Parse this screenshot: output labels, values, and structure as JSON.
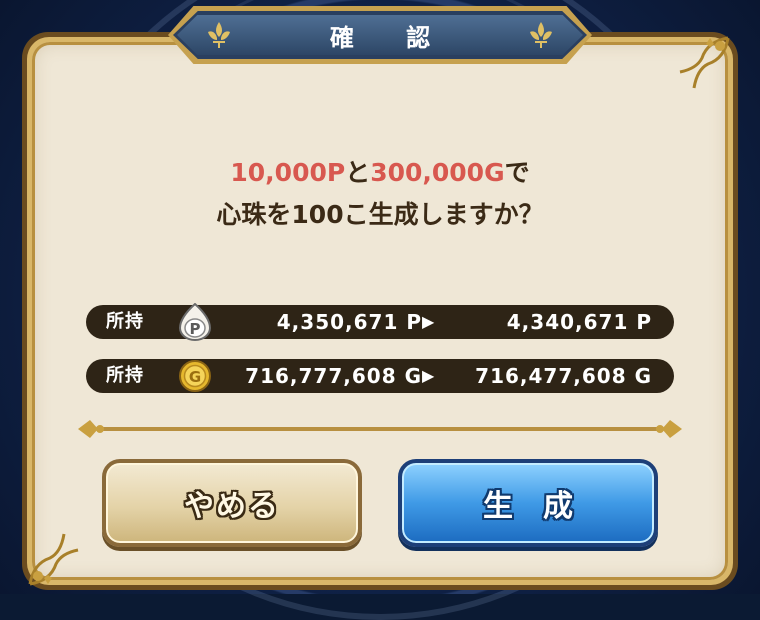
{
  "dialog": {
    "title": "確 認",
    "message": {
      "line1_cost_p": "10,000P",
      "line1_join": "と",
      "line1_cost_g": "300,000G",
      "line1_end": "で",
      "line2": "心珠を100こ生成しますか？"
    },
    "holdings": [
      {
        "label": "所持",
        "currency_icon": "p-coin-icon",
        "coin_letter": "P",
        "before": "4,350,671 P",
        "arrow": "▶",
        "after": "4,340,671 P"
      },
      {
        "label": "所持",
        "currency_icon": "gold-coin-icon",
        "coin_letter": "G",
        "before": "716,777,608 G",
        "arrow": "▶",
        "after": "716,477,608 G"
      }
    ],
    "buttons": {
      "cancel": "やめる",
      "generate": "生成"
    }
  },
  "colors": {
    "highlight_red": "#d8584f",
    "panel_face": "#efe7d6",
    "title_banner": "#2d4666",
    "row_dark": "#2e2416",
    "generate_blue": "#3f9ae6"
  }
}
